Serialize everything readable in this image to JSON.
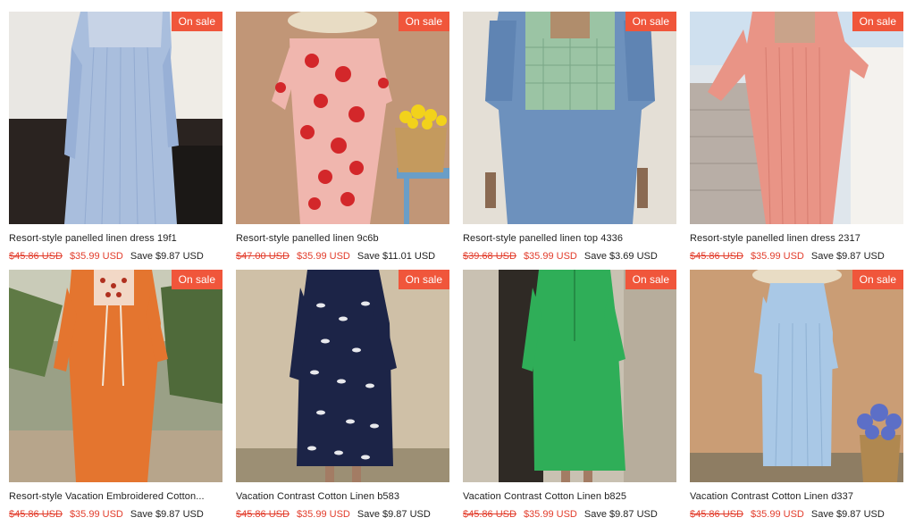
{
  "badge_label": "On sale",
  "colors": {
    "badge_bg": "#f0563b",
    "sale_price": "#e23c2b"
  },
  "products": [
    {
      "title": "Resort-style panelled linen dress 19f1",
      "compare_price": "$45.86 USD",
      "price": "$35.99 USD",
      "save": "Save $9.87 USD",
      "image": "blue-striped-linen-dress"
    },
    {
      "title": "Resort-style panelled linen 9c6b",
      "compare_price": "$47.00 USD",
      "price": "$35.99 USD",
      "save": "Save $11.01 USD",
      "image": "pink-floral-linen-dress"
    },
    {
      "title": "Resort-style panelled linen top 4336",
      "compare_price": "$39.68 USD",
      "price": "$35.99 USD",
      "save": "Save $3.69 USD",
      "image": "blue-green-linen-top"
    },
    {
      "title": "Resort-style panelled linen dress 2317",
      "compare_price": "$45.86 USD",
      "price": "$35.99 USD",
      "save": "Save $9.87 USD",
      "image": "pink-striped-linen-dress"
    },
    {
      "title": "Resort-style Vacation Embroidered Cotton...",
      "compare_price": "$45.86 USD",
      "price": "$35.99 USD",
      "save": "Save $9.87 USD",
      "image": "orange-embroidered-dress"
    },
    {
      "title": "Vacation Contrast Cotton Linen b583",
      "compare_price": "$45.86 USD",
      "price": "$35.99 USD",
      "save": "Save $9.87 USD",
      "image": "navy-leaf-print-dress"
    },
    {
      "title": "Vacation Contrast Cotton Linen b825",
      "compare_price": "$45.86 USD",
      "price": "$35.99 USD",
      "save": "Save $9.87 USD",
      "image": "green-shirt-dress"
    },
    {
      "title": "Vacation Contrast Cotton Linen d337",
      "compare_price": "$45.86 USD",
      "price": "$35.99 USD",
      "save": "Save $9.87 USD",
      "image": "light-blue-shirt-dress"
    }
  ]
}
